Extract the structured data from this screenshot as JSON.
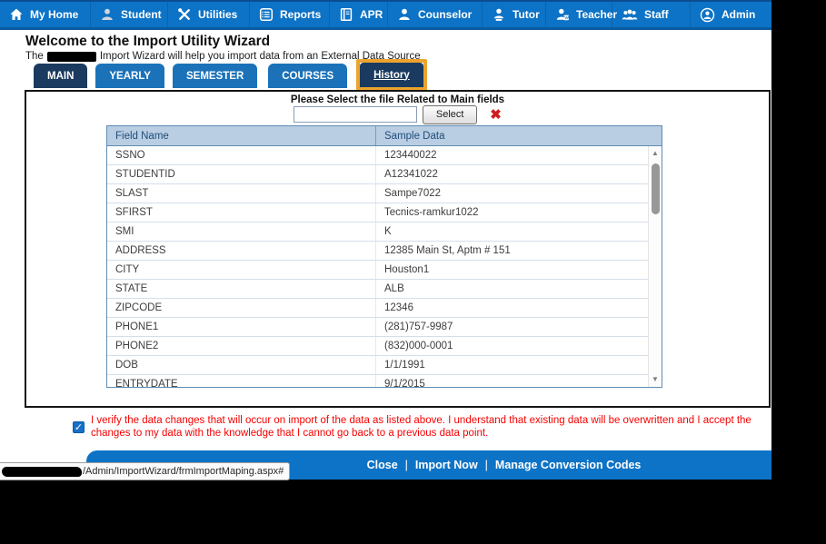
{
  "nav": {
    "items": [
      {
        "label": "My Home",
        "icon": "home-icon"
      },
      {
        "label": "Student",
        "icon": "student-icon"
      },
      {
        "label": "Utilities",
        "icon": "utilities-icon"
      },
      {
        "label": "Reports",
        "icon": "reports-icon"
      },
      {
        "label": "APR",
        "icon": "apr-icon"
      },
      {
        "label": "Counselor",
        "icon": "counselor-icon"
      },
      {
        "label": "Tutor",
        "icon": "tutor-icon"
      },
      {
        "label": "Teacher",
        "icon": "teacher-icon"
      },
      {
        "label": "Staff",
        "icon": "staff-icon"
      },
      {
        "label": "Admin",
        "icon": "admin-icon"
      }
    ]
  },
  "page": {
    "title": "Welcome to the Import Utility Wizard",
    "subtitle_prefix": "The",
    "subtitle_rest": "Import Wizard will help you import data from an External Data Source"
  },
  "tabs": {
    "items": [
      {
        "label": "MAIN",
        "active": true
      },
      {
        "label": "YEARLY",
        "active": false
      },
      {
        "label": "SEMESTER",
        "active": false
      },
      {
        "label": "COURSES",
        "active": false
      }
    ],
    "history": {
      "label": "History",
      "highlighted": true,
      "highlight_color": "#eca42f"
    }
  },
  "file_select": {
    "instruction": "Please Select the file Related to Main fields",
    "input_value": "",
    "button_label": "Select",
    "clear_glyph": "✖"
  },
  "table": {
    "columns": [
      "Field Name",
      "Sample Data"
    ],
    "rows": [
      {
        "field": "SSNO",
        "sample": "123440022"
      },
      {
        "field": "STUDENTID",
        "sample": "A12341022"
      },
      {
        "field": "SLAST",
        "sample": "Sampe7022"
      },
      {
        "field": "SFIRST",
        "sample": "Tecnics-ramkur1022"
      },
      {
        "field": "SMI",
        "sample": "K"
      },
      {
        "field": "ADDRESS",
        "sample": "12385 Main St, Aptm # 151"
      },
      {
        "field": "CITY",
        "sample": "Houston1"
      },
      {
        "field": "STATE",
        "sample": "ALB"
      },
      {
        "field": "ZIPCODE",
        "sample": "12346"
      },
      {
        "field": "PHONE1",
        "sample": "(281)757-9987"
      },
      {
        "field": "PHONE2",
        "sample": "(832)000-0001"
      },
      {
        "field": "DOB",
        "sample": "1/1/1991"
      },
      {
        "field": "ENTRYDATE",
        "sample": "9/1/2015"
      }
    ],
    "scroll_up_glyph": "▲",
    "scroll_down_glyph": "▼"
  },
  "verify": {
    "checked": true,
    "check_glyph": "✓",
    "text": "I verify the data changes that will occur on import of the data as listed above. I understand that existing data will be overwritten and I accept the changes to my data with the knowledge that I cannot go back to a previous data point."
  },
  "footer": {
    "links": [
      "Close",
      "Import Now",
      "Manage Conversion Codes"
    ],
    "separator": "|"
  },
  "status": {
    "url_path": "/Admin/ImportWizard/frmImportMaping.aspx#"
  },
  "colors": {
    "nav_blue": "#0d73c6",
    "tab_blue": "#1b72b9",
    "tab_dark_navy": "#1b3a5f",
    "highlight_orange": "#eca42f",
    "table_header_bg": "#b9cde3",
    "table_header_text": "#1f4e79",
    "verify_red": "#f70000",
    "clear_x_red": "#cf1d1d"
  }
}
